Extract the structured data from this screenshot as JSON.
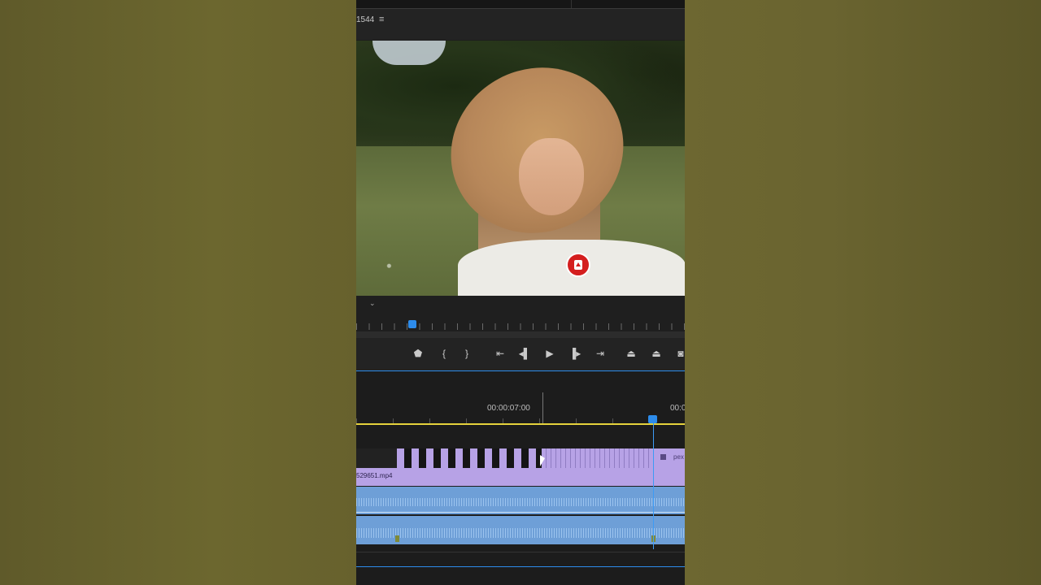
{
  "program_monitor": {
    "sequence_number": "1544",
    "menu_icon": "hamburger-menu-icon",
    "fit_dropdown": "chevron-down-icon",
    "overlay_icon": "record-badge-icon"
  },
  "transport": {
    "buttons": [
      {
        "name": "add-marker-button",
        "glyph": "⬟"
      },
      {
        "name": "mark-in-button",
        "glyph": "{"
      },
      {
        "name": "mark-out-button",
        "glyph": "}"
      },
      {
        "name": "go-to-in-button",
        "glyph": "⇤"
      },
      {
        "name": "step-back-button",
        "glyph": "◂▌"
      },
      {
        "name": "play-button",
        "glyph": "▶"
      },
      {
        "name": "step-forward-button",
        "glyph": "▐▸"
      },
      {
        "name": "go-to-out-button",
        "glyph": "⇥"
      },
      {
        "name": "lift-button",
        "glyph": "⏏"
      },
      {
        "name": "extract-button",
        "glyph": "⏏"
      },
      {
        "name": "export-frame-button",
        "glyph": "◙"
      }
    ]
  },
  "timeline": {
    "timecode_1": "00:00:07:00",
    "timecode_2": "00:0",
    "clip_name_main": "529651.mp4",
    "clip_name_next": "pex"
  },
  "colors": {
    "accent_blue": "#2d8ceb",
    "work_area_yellow": "#e5d23c",
    "video_clip": "#b7a2e6",
    "audio_clip": "#6e9fd7"
  }
}
